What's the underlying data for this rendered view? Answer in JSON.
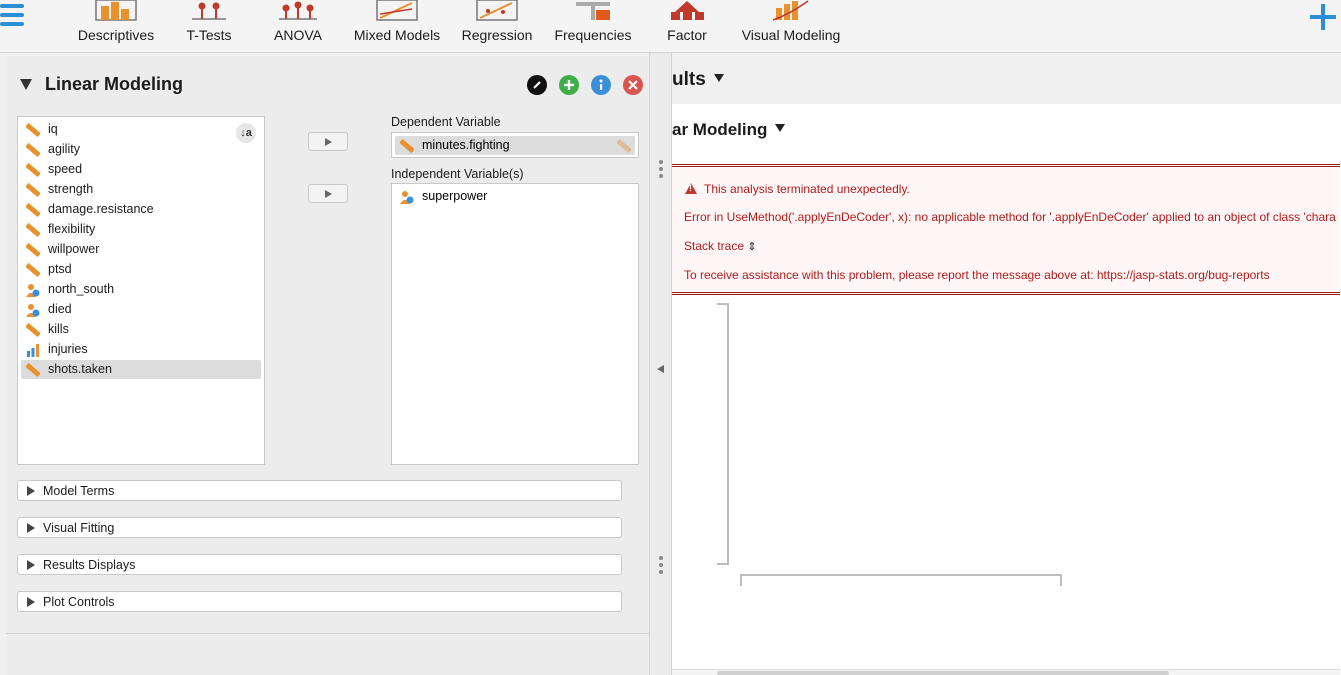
{
  "ribbon": {
    "items": [
      {
        "label": "Descriptives",
        "icon": "descriptives-icon"
      },
      {
        "label": "T-Tests",
        "icon": "ttests-icon"
      },
      {
        "label": "ANOVA",
        "icon": "anova-icon"
      },
      {
        "label": "Mixed Models",
        "icon": "mixed-models-icon"
      },
      {
        "label": "Regression",
        "icon": "regression-icon"
      },
      {
        "label": "Frequencies",
        "icon": "frequencies-icon"
      },
      {
        "label": "Factor",
        "icon": "factor-icon"
      },
      {
        "label": "Visual Modeling",
        "icon": "visual-modeling-icon"
      }
    ]
  },
  "analysis": {
    "title": "Linear Modeling",
    "variables": [
      {
        "name": "iq",
        "type": "scale"
      },
      {
        "name": "agility",
        "type": "scale"
      },
      {
        "name": "speed",
        "type": "scale"
      },
      {
        "name": "strength",
        "type": "scale"
      },
      {
        "name": "damage.resistance",
        "type": "scale"
      },
      {
        "name": "flexibility",
        "type": "scale"
      },
      {
        "name": "willpower",
        "type": "scale"
      },
      {
        "name": "ptsd",
        "type": "scale"
      },
      {
        "name": "north_south",
        "type": "nominal"
      },
      {
        "name": "died",
        "type": "nominal"
      },
      {
        "name": "kills",
        "type": "scale"
      },
      {
        "name": "injuries",
        "type": "ordinal"
      },
      {
        "name": "shots.taken",
        "type": "scale",
        "selected": true
      }
    ],
    "dependent_label": "Dependent Variable",
    "dependent_value": "minutes.fighting",
    "independent_label": "Independent Variable(s)",
    "independent_values": [
      "superpower"
    ],
    "sections": [
      "Model Terms",
      "Visual Fitting",
      "Results Displays",
      "Plot Controls"
    ]
  },
  "results": {
    "title": "ults",
    "subtitle": "ar Modeling",
    "error_title": "This analysis terminated unexpectedly.",
    "error_message": "Error in UseMethod('.applyEnDeCoder', x): no applicable method for '.applyEnDeCoder' applied to an object of class 'chara",
    "stack_trace": "Stack trace",
    "report_message": "To receive assistance with this problem, please report the message above at: https://jasp-stats.org/bug-reports"
  },
  "colors": {
    "accent": "#2b8fd6",
    "scale_icon": "#e8912d",
    "error_text": "#b01c1c",
    "edit_btn": "#111111",
    "add_btn": "#3fae49",
    "info_btn": "#3a8fd9",
    "close_btn": "#d9534f"
  }
}
